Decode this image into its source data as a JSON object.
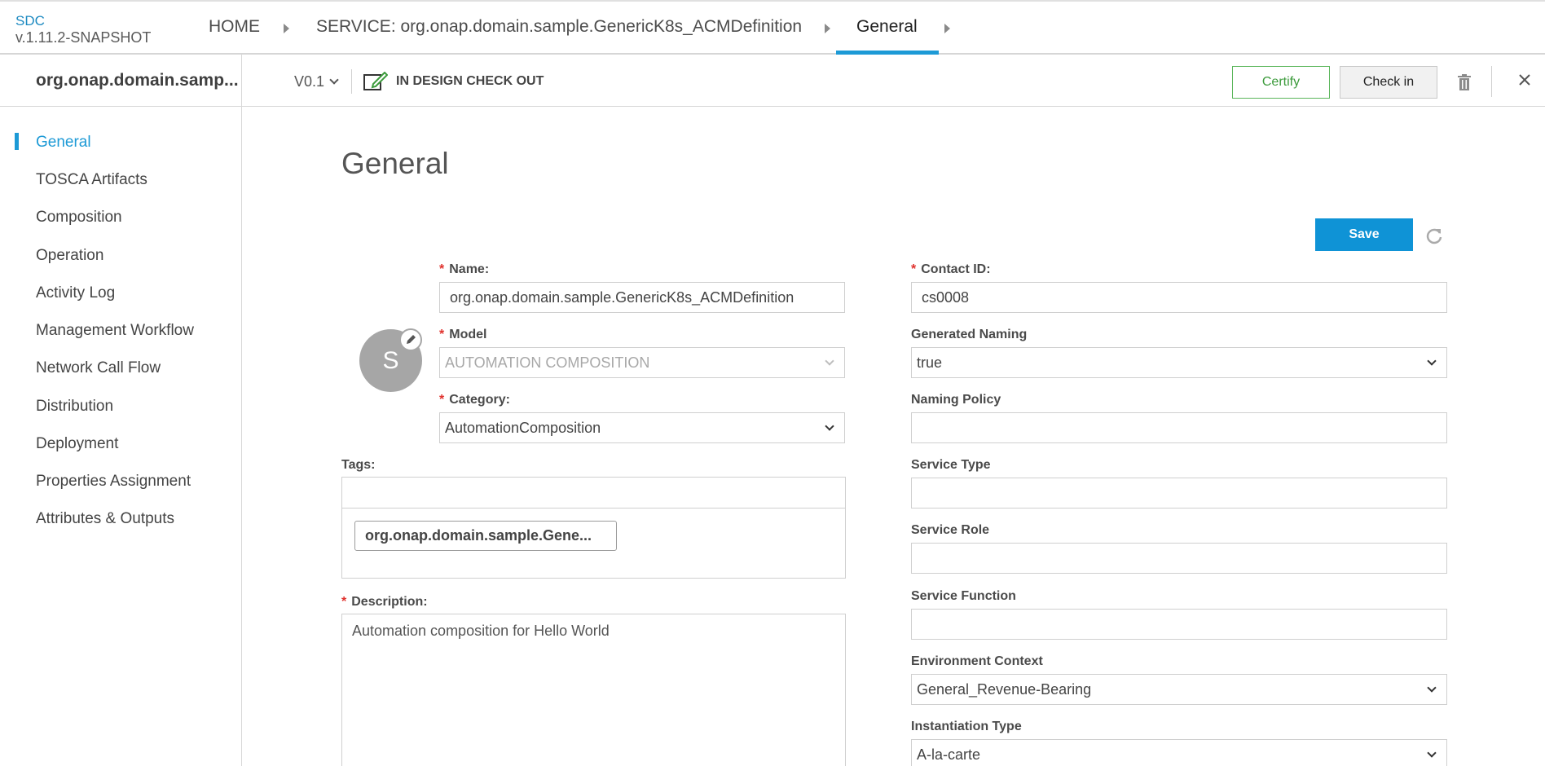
{
  "app": {
    "brand": "SDC",
    "version": "v.1.11.2-SNAPSHOT"
  },
  "breadcrumb": {
    "home": "HOME",
    "service": "SERVICE: org.onap.domain.sample.GenericK8s_ACMDefinition",
    "current": "General"
  },
  "subbar": {
    "entity_name": "org.onap.domain.samp...",
    "version": "V0.1",
    "status": "IN DESIGN CHECK OUT",
    "certify_label": "Certify",
    "checkin_label": "Check in"
  },
  "sidebar": {
    "items": [
      {
        "label": "General"
      },
      {
        "label": "TOSCA Artifacts"
      },
      {
        "label": "Composition"
      },
      {
        "label": "Operation"
      },
      {
        "label": "Activity Log"
      },
      {
        "label": "Management Workflow"
      },
      {
        "label": "Network Call Flow"
      },
      {
        "label": "Distribution"
      },
      {
        "label": "Deployment"
      },
      {
        "label": "Properties Assignment"
      },
      {
        "label": "Attributes & Outputs"
      }
    ]
  },
  "main": {
    "title": "General",
    "save_label": "Save",
    "avatar_letter": "S",
    "form": {
      "name": {
        "label": "Name:",
        "value": "org.onap.domain.sample.GenericK8s_ACMDefinition"
      },
      "model": {
        "label": "Model",
        "value": "AUTOMATION COMPOSITION"
      },
      "category": {
        "label": "Category:",
        "value": "AutomationComposition"
      },
      "tags": {
        "label": "Tags:",
        "chip": "org.onap.domain.sample.Gene..."
      },
      "description": {
        "label": "Description:",
        "value": "Automation composition for Hello World"
      },
      "contact_id": {
        "label": "Contact ID:",
        "value": "cs0008"
      },
      "generated_naming": {
        "label": "Generated Naming",
        "value": "true"
      },
      "naming_policy": {
        "label": "Naming Policy",
        "value": ""
      },
      "service_type": {
        "label": "Service Type",
        "value": ""
      },
      "service_role": {
        "label": "Service Role",
        "value": ""
      },
      "service_function": {
        "label": "Service Function",
        "value": ""
      },
      "environment_context": {
        "label": "Environment Context",
        "value": "General_Revenue-Bearing"
      },
      "instantiation_type": {
        "label": "Instantiation Type",
        "value": "A-la-carte"
      }
    }
  },
  "colors": {
    "accent": "#1d9ad6",
    "certify": "#3c9b3c",
    "required": "#e0312c"
  }
}
